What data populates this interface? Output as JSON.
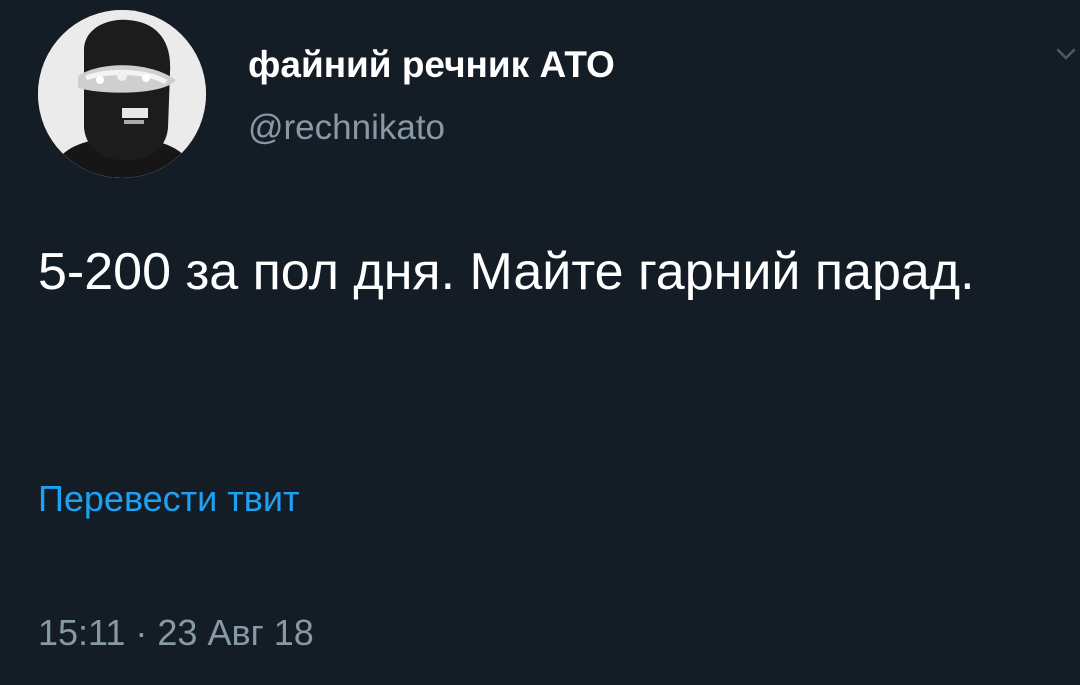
{
  "user": {
    "display_name": "файний речник АТО",
    "handle": "@rechnikato",
    "avatar_icon": "masked-person-avatar"
  },
  "tweet": {
    "text": "5-200 за пол дня. Майте гарний парад.",
    "translate_label": "Перевести твит",
    "timestamp": "15:11 · 23 Авг 18"
  },
  "menu": {
    "icon": "chevron-down-icon"
  },
  "colors": {
    "background": "#141d26",
    "text": "#ffffff",
    "secondary": "#8899a6",
    "link": "#1da1f2"
  }
}
